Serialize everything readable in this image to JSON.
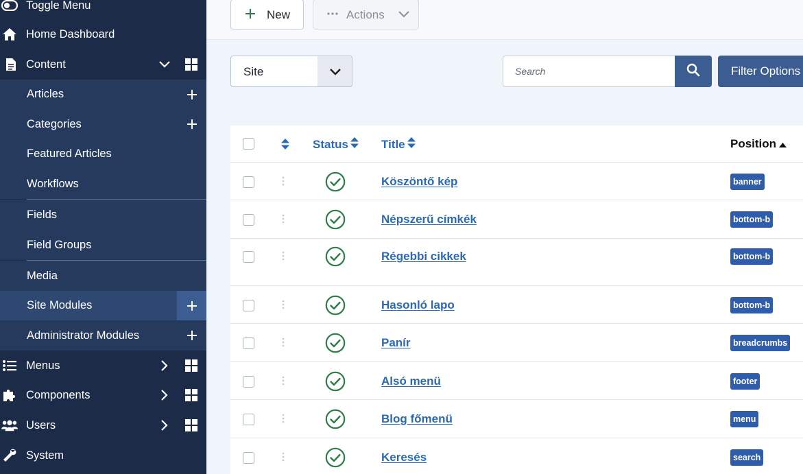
{
  "sidebar": {
    "toggle": "Toggle Menu",
    "home": "Home Dashboard",
    "content": "Content",
    "content_items": [
      "Articles",
      "Categories",
      "Featured Articles",
      "Workflows",
      "Fields",
      "Field Groups",
      "Media",
      "Site Modules",
      "Administrator Modules"
    ],
    "menus": "Menus",
    "components": "Components",
    "users": "Users",
    "system": "System"
  },
  "toolbar": {
    "new_label": "New",
    "actions_label": "Actions"
  },
  "filters": {
    "client_value": "Site",
    "search_placeholder": "Search",
    "filter_options_label": "Filter Options"
  },
  "table": {
    "headers": {
      "status": "Status",
      "title": "Title",
      "position": "Position"
    },
    "rows": [
      {
        "title": "Köszöntő kép",
        "position": "banner",
        "status": "published"
      },
      {
        "title": "Népszerű címkék",
        "position": "bottom-b",
        "status": "published"
      },
      {
        "title": "Régebbi cikkek",
        "position": "bottom-b",
        "status": "published"
      },
      {
        "title": "Hasonló lapo",
        "position": "bottom-b",
        "status": "published"
      },
      {
        "title": "Panír",
        "position": "breadcrumbs",
        "status": "published"
      },
      {
        "title": "Alsó menü",
        "position": "footer",
        "status": "published"
      },
      {
        "title": "Blog főmenü",
        "position": "menu",
        "status": "published"
      },
      {
        "title": "Keresés",
        "position": "search",
        "status": "published"
      }
    ]
  },
  "colors": {
    "sidebar": "#1c2b48",
    "accent": "#3c5d91",
    "link": "#2a69b8",
    "published": "#2e7d48"
  }
}
